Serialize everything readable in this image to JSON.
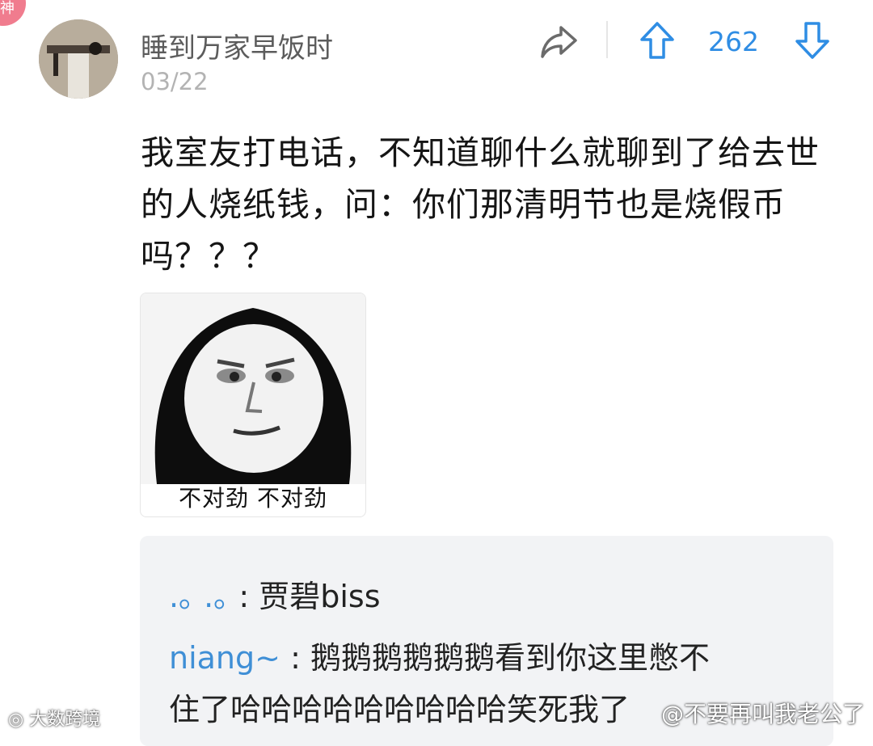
{
  "corner_badge": "神",
  "post": {
    "username": "睡到万家早饭时",
    "date": "03/22",
    "vote_count": "262",
    "body": "我室友打电话，不知道聊什么就聊到了给去世的人烧纸钱，问：你们那清明节也是烧假币吗？？？",
    "meme_caption": "不对劲 不对劲"
  },
  "icons": {
    "share": "share-icon",
    "upvote": "arrow-up-icon",
    "downvote": "arrow-down-icon"
  },
  "replies": [
    {
      "name": ".｡ .｡",
      "separator": " : ",
      "text": "贾碧biss"
    },
    {
      "name": "niang~",
      "separator": " : ",
      "text": "鹅鹅鹅鹅鹅鹅看到你这里憋不",
      "text_cont": "住了哈哈哈哈哈哈哈哈哈笑死我了"
    }
  ],
  "watermarks": {
    "left": "大数跨境",
    "right": "@不要再叫我老公了"
  },
  "colors": {
    "accent": "#2f8de4",
    "reply_name": "#3f8fd6",
    "badge": "#f07c8e"
  }
}
